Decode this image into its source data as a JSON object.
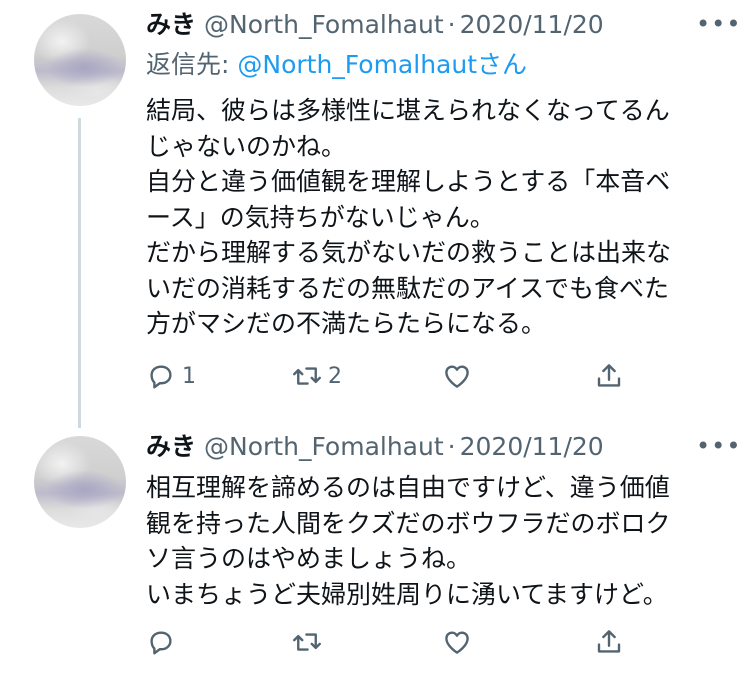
{
  "tweets": [
    {
      "display_name": "みき",
      "handle": "@North_Fomalhaut",
      "separator": "·",
      "date": "2020/11/20",
      "more": "•••",
      "reply_prefix": "返信先: ",
      "reply_mention": "@North_Fomalhautさん",
      "text": "結局、彼らは多様性に堪えられなくなってるん\nじゃないのかね。\n自分と違う価値観を理解しようとする「本音ベ\nース」の気持ちがないじゃん。\nだから理解する気がないだの救うことは出来な\nいだの消耗するだの無駄だのアイスでも食べた\n方がマシだの不満たらたらになる。",
      "reply_count": "1",
      "retweet_count": "2",
      "like_count": "",
      "icons": [
        "reply-icon",
        "retweet-icon",
        "like-icon",
        "share-icon"
      ]
    },
    {
      "display_name": "みき",
      "handle": "@North_Fomalhaut",
      "separator": "·",
      "date": "2020/11/20",
      "more": "•••",
      "text": "相互理解を諦めるのは自由ですけど、違う価値\n観を持った人間をクズだのボウフラだのボロク\nソ言うのはやめましょうね。\nいまちょうど夫婦別姓周りに湧いてますけど。",
      "reply_count": "",
      "retweet_count": "",
      "like_count": "",
      "icons": [
        "reply-icon",
        "retweet-icon",
        "like-icon",
        "share-icon"
      ]
    }
  ],
  "colors": {
    "text": "#0f1419",
    "secondary": "#536471",
    "link": "#1d9bf0",
    "thread_line": "#cfd9de"
  }
}
